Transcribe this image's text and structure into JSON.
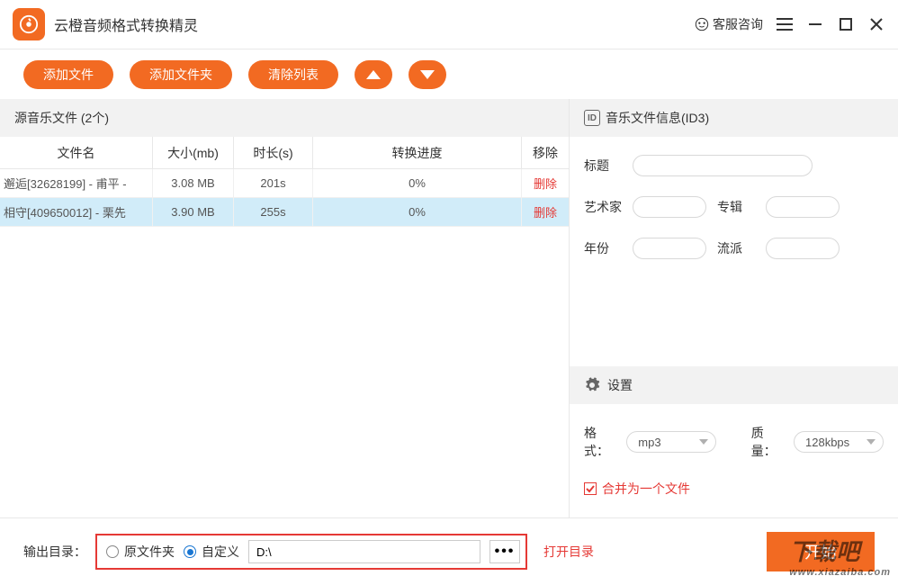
{
  "app": {
    "title": "云橙音频格式转换精灵",
    "support": "客服咨询"
  },
  "toolbar": {
    "add_file": "添加文件",
    "add_folder": "添加文件夹",
    "clear_list": "清除列表"
  },
  "source": {
    "header": "源音乐文件 (2个)",
    "columns": {
      "name": "文件名",
      "size": "大小(mb)",
      "duration": "时长(s)",
      "progress": "转换进度",
      "remove": "移除"
    },
    "rows": [
      {
        "name": "邂逅[32628199] - 甫平 -",
        "size": "3.08 MB",
        "duration": "201s",
        "progress": "0%",
        "remove": "删除"
      },
      {
        "name": "相守[409650012] - 栗先",
        "size": "3.90 MB",
        "duration": "255s",
        "progress": "0%",
        "remove": "删除"
      }
    ]
  },
  "id3": {
    "header": "音乐文件信息(ID3)",
    "title_label": "标题",
    "artist_label": "艺术家",
    "album_label": "专辑",
    "year_label": "年份",
    "genre_label": "流派",
    "title": "",
    "artist": "",
    "album": "",
    "year": "",
    "genre": ""
  },
  "settings": {
    "header": "设置",
    "format_label": "格式：",
    "format_value": "mp3",
    "quality_label": "质量：",
    "quality_value": "128kbps",
    "merge_label": "合并为一个文件",
    "merge_checked": true
  },
  "output": {
    "label": "输出目录：",
    "original_label": "原文件夹",
    "custom_label": "自定义",
    "path": "D:\\",
    "open_dir": "打开目录",
    "selected": "custom"
  },
  "start": {
    "label": "开始"
  },
  "watermark": {
    "text": "下载吧",
    "url": "www.xiazaiba.com"
  }
}
